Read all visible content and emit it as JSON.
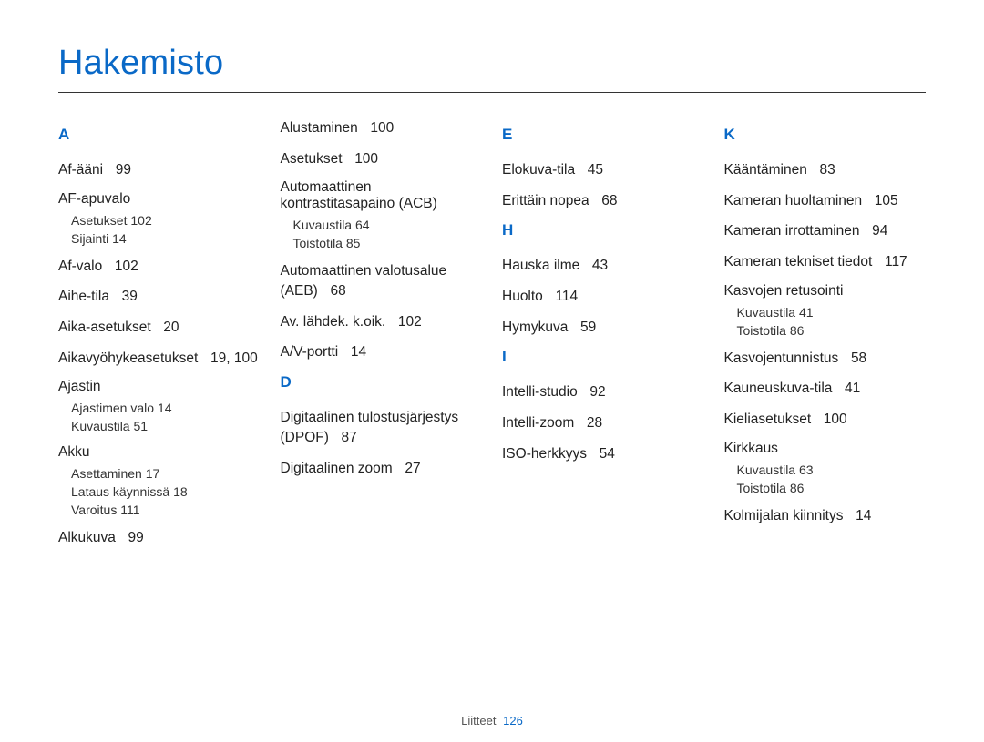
{
  "title": "Hakemisto",
  "footer": {
    "label": "Liitteet",
    "page": "126"
  },
  "columns": [
    {
      "sections": [
        {
          "letter": "A",
          "entries": [
            {
              "label": "Af-ääni",
              "pages": "99"
            },
            {
              "label": "AF-apuvalo",
              "subs": [
                {
                  "label": "Asetukset",
                  "pages": "102"
                },
                {
                  "label": "Sijainti",
                  "pages": "14"
                }
              ]
            },
            {
              "label": "Af-valo",
              "pages": "102"
            },
            {
              "label": "Aihe-tila",
              "pages": "39"
            },
            {
              "label": "Aika-asetukset",
              "pages": "20"
            },
            {
              "label": "Aikavyöhykeasetukset",
              "pages": "19, 100"
            },
            {
              "label": "Ajastin",
              "subs": [
                {
                  "label": "Ajastimen valo",
                  "pages": "14"
                },
                {
                  "label": "Kuvaustila",
                  "pages": "51"
                }
              ]
            },
            {
              "label": "Akku",
              "subs": [
                {
                  "label": "Asettaminen",
                  "pages": "17"
                },
                {
                  "label": "Lataus käynnissä",
                  "pages": "18"
                },
                {
                  "label": "Varoitus",
                  "pages": "111"
                }
              ]
            },
            {
              "label": "Alkukuva",
              "pages": "99"
            }
          ]
        }
      ]
    },
    {
      "sections": [
        {
          "letter": "",
          "entries": [
            {
              "label": "Alustaminen",
              "pages": "100"
            },
            {
              "label": "Asetukset",
              "pages": "100"
            },
            {
              "label": "Automaattinen kontrastitasapaino (ACB)",
              "subs": [
                {
                  "label": "Kuvaustila",
                  "pages": "64"
                },
                {
                  "label": "Toistotila",
                  "pages": "85"
                }
              ]
            },
            {
              "label": "Automaattinen valotusalue (AEB)",
              "pages": "68"
            },
            {
              "label": "Av. lähdek. k.oik.",
              "pages": "102"
            },
            {
              "label": "A/V-portti",
              "pages": "14"
            }
          ]
        },
        {
          "letter": "D",
          "entries": [
            {
              "label": "Digitaalinen tulostusjärjestys (DPOF)",
              "pages": "87"
            },
            {
              "label": "Digitaalinen zoom",
              "pages": "27"
            }
          ]
        }
      ]
    },
    {
      "sections": [
        {
          "letter": "E",
          "entries": [
            {
              "label": "Elokuva-tila",
              "pages": "45"
            },
            {
              "label": "Erittäin nopea",
              "pages": "68"
            }
          ]
        },
        {
          "letter": "H",
          "entries": [
            {
              "label": "Hauska ilme",
              "pages": "43"
            },
            {
              "label": "Huolto",
              "pages": "114"
            },
            {
              "label": "Hymykuva",
              "pages": "59"
            }
          ]
        },
        {
          "letter": "I",
          "entries": [
            {
              "label": "Intelli-studio",
              "pages": "92"
            },
            {
              "label": "Intelli-zoom",
              "pages": "28"
            },
            {
              "label": "ISO-herkkyys",
              "pages": "54"
            }
          ]
        }
      ]
    },
    {
      "sections": [
        {
          "letter": "K",
          "entries": [
            {
              "label": "Kääntäminen",
              "pages": "83"
            },
            {
              "label": "Kameran huoltaminen",
              "pages": "105"
            },
            {
              "label": "Kameran irrottaminen",
              "pages": "94"
            },
            {
              "label": "Kameran tekniset tiedot",
              "pages": "117"
            },
            {
              "label": "Kasvojen retusointi",
              "subs": [
                {
                  "label": "Kuvaustila",
                  "pages": "41"
                },
                {
                  "label": "Toistotila",
                  "pages": "86"
                }
              ]
            },
            {
              "label": "Kasvojentunnistus",
              "pages": "58"
            },
            {
              "label": "Kauneuskuva-tila",
              "pages": "41"
            },
            {
              "label": "Kieliasetukset",
              "pages": "100"
            },
            {
              "label": "Kirkkaus",
              "subs": [
                {
                  "label": "Kuvaustila",
                  "pages": "63"
                },
                {
                  "label": "Toistotila",
                  "pages": "86"
                }
              ]
            },
            {
              "label": "Kolmijalan kiinnitys",
              "pages": "14"
            }
          ]
        }
      ]
    }
  ]
}
